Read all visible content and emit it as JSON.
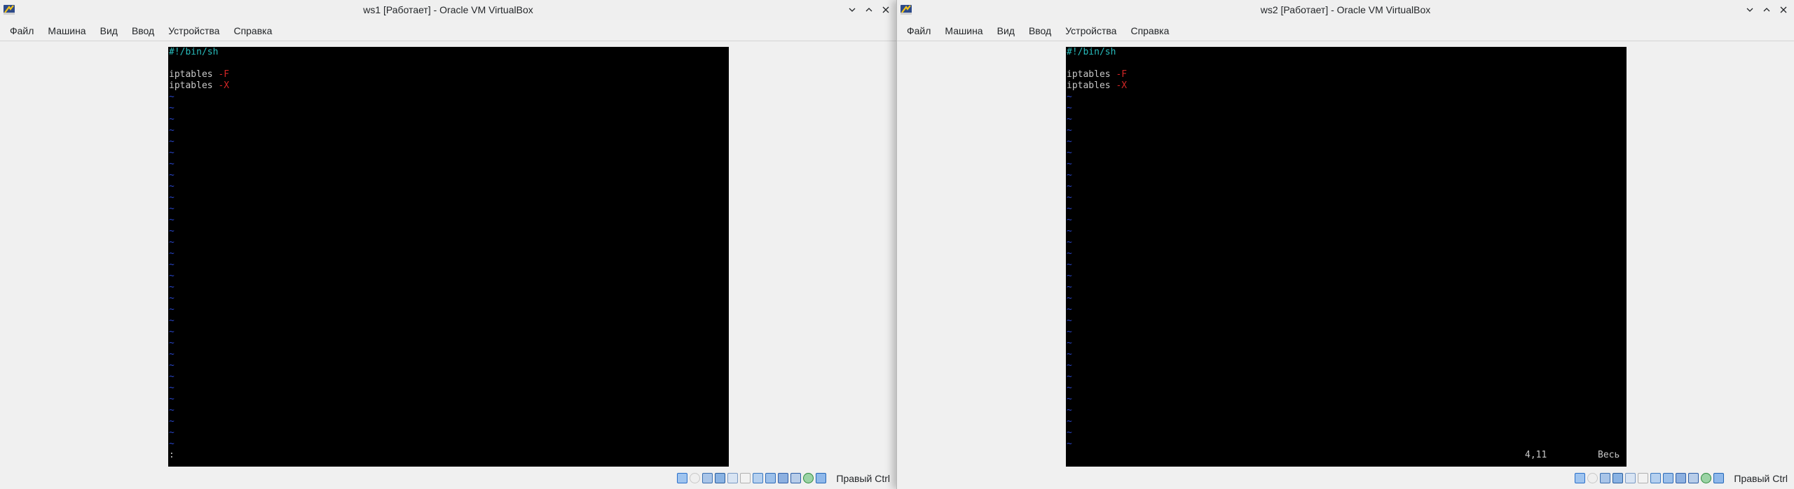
{
  "windows": [
    {
      "title": "ws1 [Работает] - Oracle VM VirtualBox",
      "menu": [
        "Файл",
        "Машина",
        "Вид",
        "Ввод",
        "Устройства",
        "Справка"
      ],
      "terminal": {
        "shebang": "#!/bin/sh",
        "lines": [
          {
            "cmd": "iptables ",
            "flag": "-F"
          },
          {
            "cmd": "iptables ",
            "flag": "-X"
          }
        ],
        "tilde": "~",
        "cmdline": ":",
        "position": "",
        "scroll": ""
      },
      "host_key": "Правый Ctrl"
    },
    {
      "title": "ws2 [Работает] - Oracle VM VirtualBox",
      "menu": [
        "Файл",
        "Машина",
        "Вид",
        "Ввод",
        "Устройства",
        "Справка"
      ],
      "terminal": {
        "shebang": "#!/bin/sh",
        "lines": [
          {
            "cmd": "iptables ",
            "flag": "-F"
          },
          {
            "cmd": "iptables ",
            "flag": "-X"
          }
        ],
        "tilde": "~",
        "cmdline": "",
        "position": "4,11",
        "scroll": "Весь"
      },
      "host_key": "Правый Ctrl"
    }
  ],
  "status_icons": [
    "hard-disk-icon",
    "optical-drive-icon",
    "audio-icon",
    "network-icon",
    "usb-icon",
    "shared-folders-icon",
    "display-icon",
    "video-capture-icon",
    "recording-icon",
    "cpu-icon",
    "mouse-integration-icon",
    "keyboard-icon"
  ],
  "colors": {
    "cyan": "#28bcbc",
    "red": "#d22626",
    "tilde": "#2845c8",
    "terminal_bg": "#000000"
  }
}
